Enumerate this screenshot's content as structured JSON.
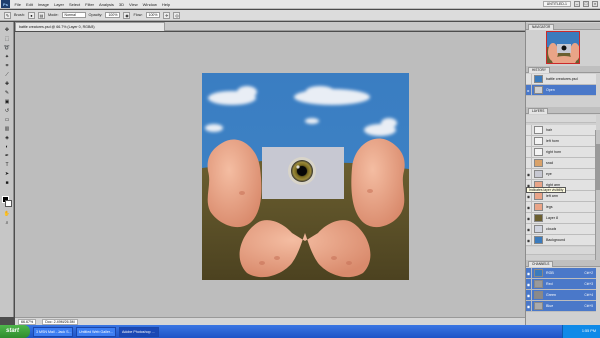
{
  "menubar": {
    "logo": "Ps",
    "items": [
      "File",
      "Edit",
      "Image",
      "Layer",
      "Select",
      "Filter",
      "Analysis",
      "3D",
      "View",
      "Window",
      "Help"
    ],
    "workspace": "UNTITLED-1",
    "window_buttons": [
      "–",
      "□",
      "×"
    ]
  },
  "optbar": {
    "brush_label": "Brush:",
    "mode_label": "Mode:",
    "mode_value": "Normal",
    "opacity_label": "Opacity:",
    "opacity_value": "100%",
    "flow_label": "Flow:",
    "flow_value": "100%"
  },
  "document": {
    "tab_title": "battle creatures.psd @ 66.7% (Layer 0, RGB/8)",
    "zoom": "66.67%",
    "doc_size": "Doc: 2.49M/26.5M"
  },
  "colors": {
    "sky": "#3b7bbd",
    "ground": "#6e5f2e",
    "flesh": "#e9a487",
    "selection_blue": "#4a78c9",
    "taskbar": "#245edb",
    "start_green": "#3c9a38"
  },
  "tools": [
    "move-icon",
    "marquee-icon",
    "lasso-icon",
    "magic-wand-icon",
    "crop-icon",
    "eyedropper-icon",
    "healing-icon",
    "brush-icon",
    "clone-stamp-icon",
    "history-brush-icon",
    "eraser-icon",
    "gradient-icon",
    "blur-icon",
    "dodge-icon",
    "pen-icon",
    "type-icon",
    "path-select-icon",
    "shape-icon",
    "hand-icon",
    "zoom-icon"
  ],
  "panels": {
    "navigator_tab": "NAVIGATOR",
    "history_tab": "HISTORY",
    "history_items": [
      {
        "label": "battle creatures.psd",
        "selected": false
      },
      {
        "label": "Open",
        "selected": true
      }
    ],
    "layers_tab": "LAYERS",
    "layers": [
      {
        "label": "hair",
        "visible": false
      },
      {
        "label": "left horn",
        "visible": false
      },
      {
        "label": "right horn",
        "visible": false
      },
      {
        "label": "snail",
        "visible": false
      },
      {
        "label": "eye",
        "visible": true
      },
      {
        "label": "right arm",
        "visible": true
      },
      {
        "label": "left arm",
        "visible": true
      },
      {
        "label": "legs",
        "visible": true
      },
      {
        "label": "Layer 8",
        "visible": true
      },
      {
        "label": "clouds",
        "visible": true
      },
      {
        "label": "Background",
        "visible": true
      }
    ],
    "tooltip": "Indicates layer visibility",
    "channels_tab": "CHANNELS",
    "channels": [
      {
        "label": "RGB",
        "shortcut": "Ctrl+2"
      },
      {
        "label": "Red",
        "shortcut": "Ctrl+3"
      },
      {
        "label": "Green",
        "shortcut": "Ctrl+4"
      },
      {
        "label": "Blue",
        "shortcut": "Ctrl+5"
      }
    ]
  },
  "taskbar": {
    "start": "start",
    "tasks": [
      "3 MSN Mail - Jack S...",
      "Untitled Web Galler...",
      "Adobe Photoshop ..."
    ],
    "clock": "1:55 PM"
  }
}
